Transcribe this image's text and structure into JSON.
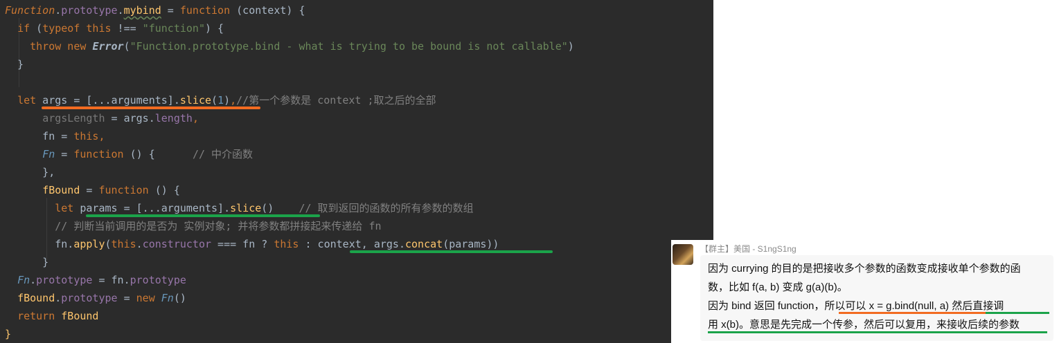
{
  "editor": {
    "lines": [
      [
        [
          "kw",
          "Function"
        ],
        [
          "plain",
          "."
        ],
        [
          "prop",
          "prototype"
        ],
        [
          "plain",
          "."
        ],
        [
          "fnw",
          "mybind"
        ],
        [
          "plain",
          " = "
        ],
        [
          "kw",
          "function"
        ],
        [
          "plain",
          " (context) {"
        ]
      ],
      [
        [
          "plain",
          "  "
        ],
        [
          "kw",
          "if"
        ],
        [
          "plain",
          " ("
        ],
        [
          "kw",
          "typeof this"
        ],
        [
          "plain",
          " !== "
        ],
        [
          "str",
          "\"function\""
        ],
        [
          "plain",
          ") {"
        ]
      ],
      [
        [
          "plain",
          "    "
        ],
        [
          "kw",
          "throw new"
        ],
        [
          "plain",
          " "
        ],
        [
          "err",
          "Error"
        ],
        [
          "plain",
          "("
        ],
        [
          "str",
          "\"Function.prototype.bind - what is trying to be bound is not callable\""
        ],
        [
          "plain",
          ")"
        ]
      ],
      [
        [
          "plain",
          "  }"
        ]
      ],
      [
        [
          "plain",
          ""
        ]
      ],
      [
        [
          "plain",
          "  "
        ],
        [
          "kw",
          "let"
        ],
        [
          "plain",
          " args = [...arguments]."
        ],
        [
          "fn",
          "slice"
        ],
        [
          "plain",
          "("
        ],
        [
          "num",
          "1"
        ],
        [
          "plain",
          ")"
        ],
        [
          "kw",
          ","
        ],
        [
          "cmt",
          "//第一个参数是 context ;取之后的全部"
        ]
      ],
      [
        [
          "plain",
          "      "
        ],
        [
          "dim",
          "argsLength"
        ],
        [
          "plain",
          " = args."
        ],
        [
          "prop",
          "length"
        ],
        [
          "kw",
          ","
        ]
      ],
      [
        [
          "plain",
          "      fn = "
        ],
        [
          "kw",
          "this,"
        ]
      ],
      [
        [
          "plain",
          "      "
        ],
        [
          "cls",
          "Fn"
        ],
        [
          "plain",
          " = "
        ],
        [
          "kw",
          "function"
        ],
        [
          "plain",
          " () {      "
        ],
        [
          "cmt",
          "// 中介函数"
        ]
      ],
      [
        [
          "plain",
          "      },"
        ]
      ],
      [
        [
          "plain",
          "      "
        ],
        [
          "fn",
          "fBound"
        ],
        [
          "plain",
          " = "
        ],
        [
          "kw",
          "function"
        ],
        [
          "plain",
          " () {"
        ]
      ],
      [
        [
          "plain",
          "        "
        ],
        [
          "kw",
          "let"
        ],
        [
          "plain",
          " params = [...arguments]."
        ],
        [
          "fn",
          "slice"
        ],
        [
          "plain",
          "()    "
        ],
        [
          "cmt",
          "// 取到返回的函数的所有参数的数组"
        ]
      ],
      [
        [
          "plain",
          "        "
        ],
        [
          "cmt",
          "// 判断当前调用的是否为 实例对象; 并将参数都拼接起来传递给 fn"
        ]
      ],
      [
        [
          "plain",
          "        fn."
        ],
        [
          "fn",
          "apply"
        ],
        [
          "plain",
          "("
        ],
        [
          "kw",
          "this"
        ],
        [
          "plain",
          "."
        ],
        [
          "prop",
          "constructor"
        ],
        [
          "plain",
          " === fn ? "
        ],
        [
          "kw",
          "this"
        ],
        [
          "plain",
          " : context, args."
        ],
        [
          "fn",
          "concat"
        ],
        [
          "plain",
          "(params))"
        ]
      ],
      [
        [
          "plain",
          "      }"
        ]
      ],
      [
        [
          "plain",
          "  "
        ],
        [
          "cls",
          "Fn"
        ],
        [
          "plain",
          "."
        ],
        [
          "prop",
          "prototype"
        ],
        [
          "plain",
          " = fn."
        ],
        [
          "prop",
          "prototype"
        ]
      ],
      [
        [
          "plain",
          "  "
        ],
        [
          "fn",
          "fBound"
        ],
        [
          "plain",
          "."
        ],
        [
          "prop",
          "prototype"
        ],
        [
          "plain",
          " = "
        ],
        [
          "kw",
          "new"
        ],
        [
          "plain",
          " "
        ],
        [
          "cls",
          "Fn"
        ],
        [
          "plain",
          "()"
        ]
      ],
      [
        [
          "plain",
          "  "
        ],
        [
          "kw",
          "return"
        ],
        [
          "plain",
          " "
        ],
        [
          "fn",
          "fBound"
        ]
      ],
      [
        [
          "fn",
          "}"
        ]
      ]
    ],
    "colors": {
      "background": "#2b2b2b",
      "keyword": "#cc7832",
      "function": "#ffc66d",
      "string": "#6a8759",
      "number": "#6897bb",
      "comment": "#808080",
      "property": "#9876aa",
      "plain": "#a9b7c6",
      "highlight_orange": "#f26b21",
      "highlight_green": "#1ba34a"
    }
  },
  "comment": {
    "user": "【群主】美国 - S1ngS1ng",
    "avatar": "user-avatar",
    "lines": [
      "因为 currying 的目的是把接收多个参数的函数变成接收单个参数的函",
      "数，比如 f(a, b) 变成 g(a)(b)。",
      "因为 bind 返回 function，所以可以 x = g.bind(null, a) 然后直接调",
      "用 x(b)。意思是先完成一个传参，然后可以复用，来接收后续的参数"
    ]
  }
}
